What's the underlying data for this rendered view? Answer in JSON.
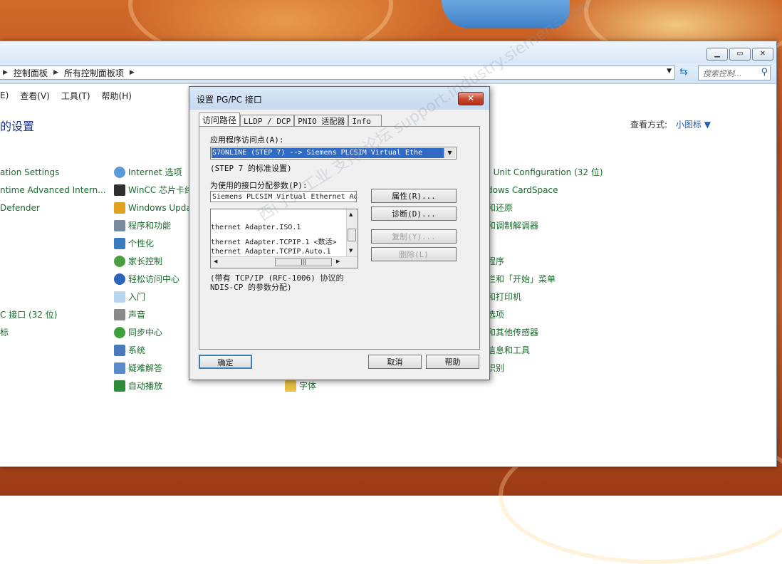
{
  "address": {
    "crumbs": [
      "控制面板",
      "所有控制面板项"
    ],
    "search_placeholder": "搜索控制..."
  },
  "menu": [
    "E)",
    "查看(V)",
    "工具(T)",
    "帮助(H)"
  ],
  "header": {
    "title": "的设置",
    "view_label": "查看方式:",
    "view_value": "小图标"
  },
  "col1": [
    "ation Settings",
    "ntime Advanced Intern...",
    "Defender",
    "",
    "",
    "",
    "",
    "",
    "C 接口 (32 位)",
    "标"
  ],
  "col2": [
    "Internet 选项",
    "WinCC 芯片卡终",
    "Windows Upda",
    "程序和功能",
    "个性化",
    "家长控制",
    "轻松访问中心",
    "入门",
    "声音",
    "同步中心",
    "系统",
    "疑难解答",
    "自动播放"
  ],
  "col3_extra": "字体",
  "col4": [
    "! Unit Configuration (32 位)",
    "dows CardSpace",
    "和还原",
    "和调制解调器",
    "",
    "程序",
    "栏和「开始」菜单",
    "和打印机",
    "选项",
    "和其他传感器",
    "信息和工具",
    "识别"
  ],
  "dialog": {
    "title": "设置 PG/PC 接口",
    "close": "✕",
    "tabs": [
      "访问路径",
      "LLDP / DCP",
      "PNIO 适配器",
      "Info"
    ],
    "access_point_label": "应用程序访问点(A):",
    "access_point_value": "S7ONLINE (STEP 7)        --> Siemens PLCSIM Virtual Ethe",
    "access_point_note": "(STEP 7 的标准设置)",
    "param_label": "为使用的接口分配参数(P):",
    "param_value": "Siemens PLCSIM Virtual Ethernet Ad",
    "list_rows": [
      "thernet Adapter.ISO.1",
      "thernet Adapter.TCPIP.1  <数活>",
      "thernet Adapter.TCPIP.Auto.1"
    ],
    "btn_props": "属性(R)...",
    "btn_diag": "诊断(D)...",
    "btn_copy": "复制(Y)...",
    "btn_delete": "删除(L)",
    "note_line1": "(带有 TCP/IP (RFC-1006) 协议的",
    "note_line2": "NDIS-CP 的参数分配)",
    "ok": "确定",
    "cancel": "取消",
    "help": "帮助"
  },
  "watermark": "西门子 工业 支持 论坛 support.industry.siemens.com"
}
